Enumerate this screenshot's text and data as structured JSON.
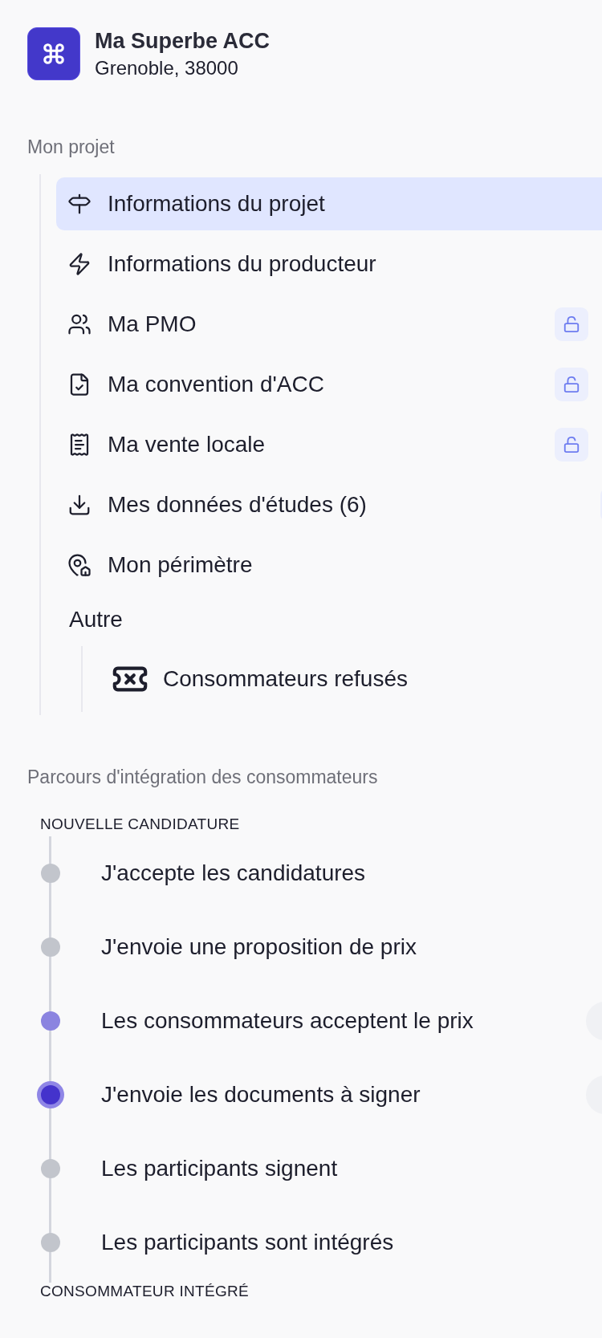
{
  "project": {
    "name": "Ma Superbe ACC",
    "location": "Grenoble, 38000"
  },
  "project_section": {
    "title": "Mon projet",
    "items": [
      {
        "label": "Informations du projet",
        "selected": true,
        "kind": "link"
      },
      {
        "label": "Informations du producteur",
        "selected": false,
        "kind": "link"
      },
      {
        "label": "Ma PMO",
        "selected": false,
        "kind": "locked"
      },
      {
        "label": "Ma convention d'ACC",
        "selected": false,
        "kind": "locked"
      },
      {
        "label": "Ma vente locale",
        "selected": false,
        "kind": "locked"
      },
      {
        "label": "Mes données d'études (6)",
        "selected": false,
        "kind": "edge"
      },
      {
        "label": "Mon périmètre",
        "selected": false,
        "kind": "link"
      }
    ],
    "group": {
      "title": "Autre",
      "items": [
        {
          "label": "Consommateurs refusés",
          "selected": false
        }
      ]
    }
  },
  "journey": {
    "title": "Parcours d'intégration des consommateurs",
    "start_label": "NOUVELLE CANDIDATURE",
    "end_label": "CONSOMMATEUR INTÉGRÉ",
    "steps": [
      {
        "label": "J'accepte les candidatures",
        "completed": false,
        "current": false,
        "kind": "plain"
      },
      {
        "label": "J'envoie une proposition de prix",
        "completed": false,
        "current": false,
        "kind": "plain"
      },
      {
        "label": "Les consommateurs acceptent le prix",
        "completed": true,
        "current": false,
        "kind": "edge"
      },
      {
        "label": "J'envoie les documents à signer",
        "completed": false,
        "current": true,
        "kind": "edge"
      },
      {
        "label": "Les participants signent",
        "completed": false,
        "current": false,
        "kind": "plain"
      },
      {
        "label": "Les participants sont intégrés",
        "completed": false,
        "current": false,
        "kind": "plain"
      }
    ]
  }
}
